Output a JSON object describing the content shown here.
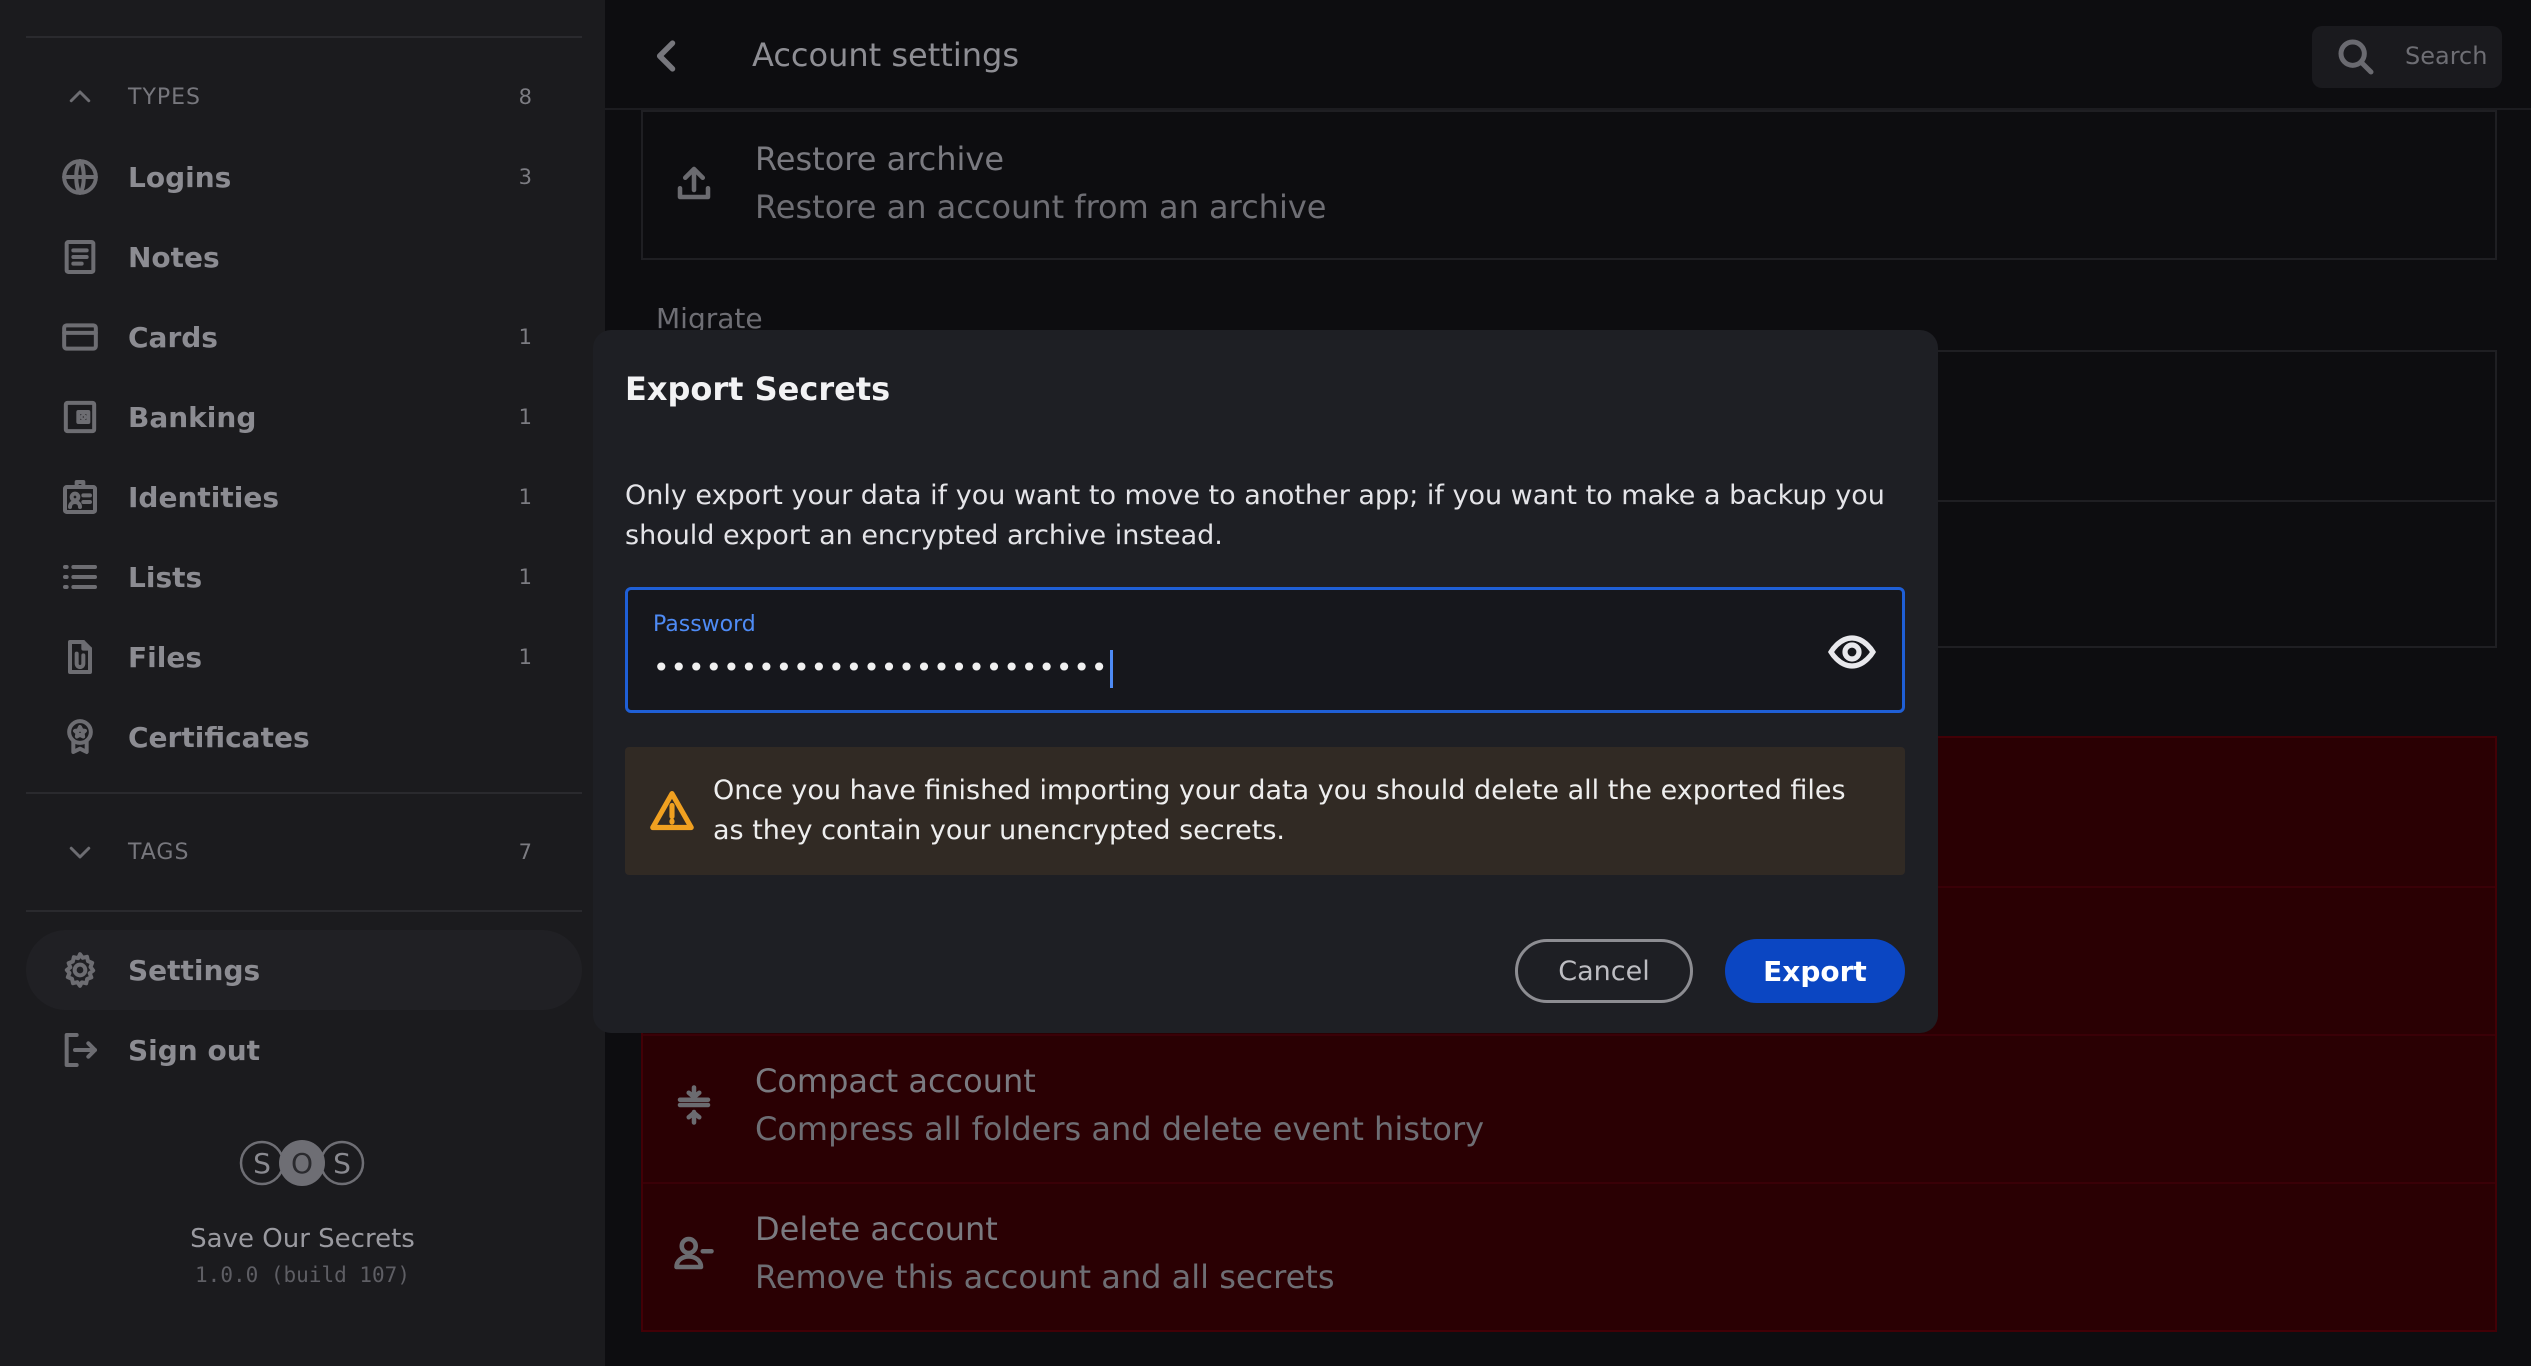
{
  "sidebar": {
    "types_header": {
      "label": "TYPES",
      "count": "8",
      "icon": "chevron-up-icon"
    },
    "types": [
      {
        "label": "Logins",
        "count": "3",
        "icon": "globe-icon"
      },
      {
        "label": "Notes",
        "count": "",
        "icon": "note-icon"
      },
      {
        "label": "Cards",
        "count": "1",
        "icon": "credit-card-icon"
      },
      {
        "label": "Banking",
        "count": "1",
        "icon": "wallet-icon"
      },
      {
        "label": "Identities",
        "count": "1",
        "icon": "id-badge-icon"
      },
      {
        "label": "Lists",
        "count": "1",
        "icon": "list-icon"
      },
      {
        "label": "Files",
        "count": "1",
        "icon": "paperclip-file-icon"
      },
      {
        "label": "Certificates",
        "count": "",
        "icon": "certificate-icon"
      }
    ],
    "tags_header": {
      "label": "TAGS",
      "count": "7",
      "icon": "chevron-down-icon"
    },
    "settings": {
      "label": "Settings",
      "icon": "gear-icon"
    },
    "signout": {
      "label": "Sign out",
      "icon": "sign-out-icon"
    },
    "logo_letters": [
      "S",
      "O",
      "S"
    ],
    "app_name": "Save Our Secrets",
    "app_version": "1.0.0 (build 107)"
  },
  "header": {
    "title": "Account settings",
    "search_label": "Search"
  },
  "background": {
    "restore": {
      "title": "Restore archive",
      "subtitle": "Restore an account from an archive"
    },
    "migrate_label": "Migrate",
    "compact": {
      "title": "Compact account",
      "subtitle": "Compress all folders and delete event history"
    },
    "delete": {
      "title": "Delete account",
      "subtitle": "Remove this account and all secrets"
    }
  },
  "modal": {
    "title": "Export Secrets",
    "description": "Only export your data if you want to move to another app; if you want to make a backup you should export an encrypted archive instead.",
    "password_label": "Password",
    "password_value": "••••••••••••••••••••••••••",
    "warning": "Once you have finished importing your data you should delete all the exported files as they contain your unencrypted secrets.",
    "cancel_label": "Cancel",
    "export_label": "Export"
  },
  "colors": {
    "accent": "#0b46c2",
    "focus_border": "#1f5fd6",
    "warning_icon": "#f0a020",
    "danger_card": "#2a0003"
  }
}
